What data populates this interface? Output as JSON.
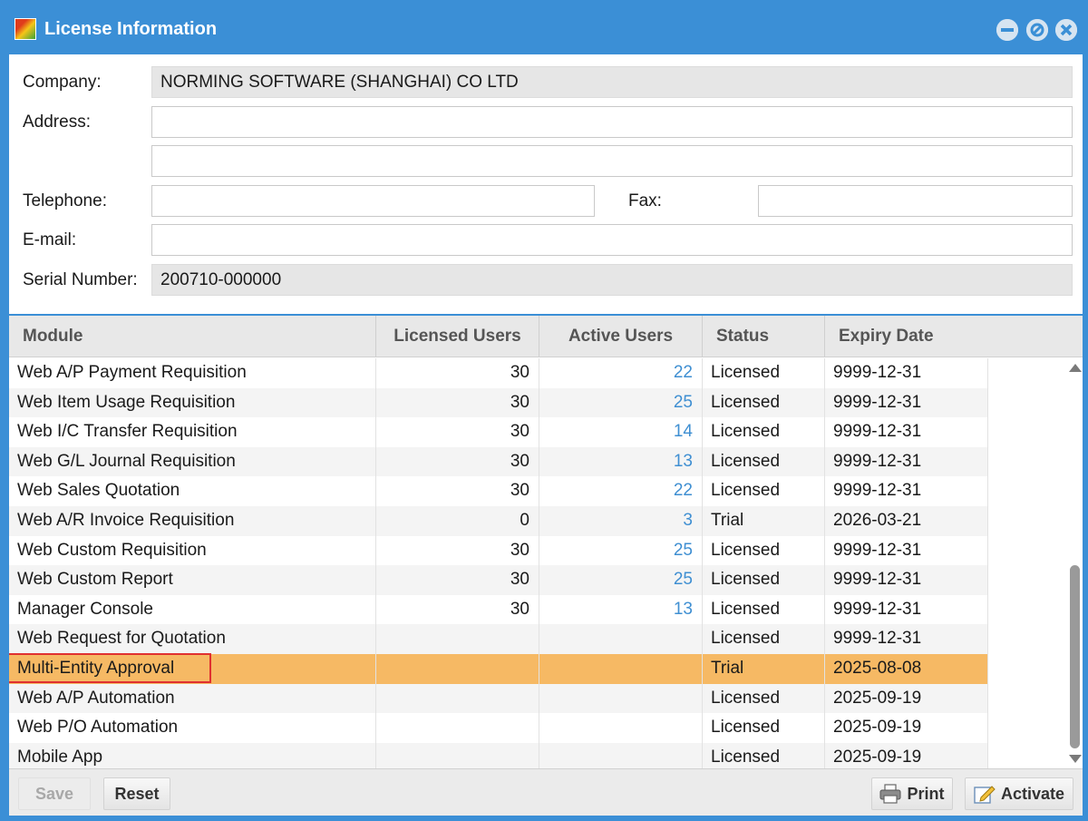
{
  "window": {
    "title": "License Information",
    "icon": "app-logo-icon"
  },
  "form": {
    "company_label": "Company:",
    "company_value": "NORMING SOFTWARE (SHANGHAI) CO LTD",
    "address_label": "Address:",
    "address_line1": "",
    "address_line2": "",
    "telephone_label": "Telephone:",
    "telephone_value": "",
    "fax_label": "Fax:",
    "fax_value": "",
    "email_label": "E-mail:",
    "email_value": "",
    "serial_label": "Serial Number:",
    "serial_value": "200710-000000"
  },
  "grid": {
    "headers": [
      "Module",
      "Licensed Users",
      "Active Users",
      "Status",
      "Expiry Date"
    ],
    "rows": [
      {
        "module": "Web A/P Payment Requisition",
        "licensed": "30",
        "active": "22",
        "status": "Licensed",
        "expiry": "9999-12-31"
      },
      {
        "module": "Web Item Usage Requisition",
        "licensed": "30",
        "active": "25",
        "status": "Licensed",
        "expiry": "9999-12-31"
      },
      {
        "module": "Web I/C Transfer Requisition",
        "licensed": "30",
        "active": "14",
        "status": "Licensed",
        "expiry": "9999-12-31"
      },
      {
        "module": "Web G/L Journal Requisition",
        "licensed": "30",
        "active": "13",
        "status": "Licensed",
        "expiry": "9999-12-31"
      },
      {
        "module": "Web Sales Quotation",
        "licensed": "30",
        "active": "22",
        "status": "Licensed",
        "expiry": "9999-12-31"
      },
      {
        "module": "Web A/R Invoice Requisition",
        "licensed": "0",
        "active": "3",
        "status": "Trial",
        "expiry": "2026-03-21"
      },
      {
        "module": "Web Custom Requisition",
        "licensed": "30",
        "active": "25",
        "status": "Licensed",
        "expiry": "9999-12-31"
      },
      {
        "module": "Web Custom Report",
        "licensed": "30",
        "active": "25",
        "status": "Licensed",
        "expiry": "9999-12-31"
      },
      {
        "module": "Manager Console",
        "licensed": "30",
        "active": "13",
        "status": "Licensed",
        "expiry": "9999-12-31"
      },
      {
        "module": "Web Request for Quotation",
        "licensed": "",
        "active": "",
        "status": "Licensed",
        "expiry": "9999-12-31"
      },
      {
        "module": "Multi-Entity Approval",
        "licensed": "",
        "active": "",
        "status": "Trial",
        "expiry": "2025-08-08",
        "selected": true
      },
      {
        "module": "Web A/P Automation",
        "licensed": "",
        "active": "",
        "status": "Licensed",
        "expiry": "2025-09-19"
      },
      {
        "module": "Web P/O Automation",
        "licensed": "",
        "active": "",
        "status": "Licensed",
        "expiry": "2025-09-19"
      },
      {
        "module": "Mobile App",
        "licensed": "",
        "active": "",
        "status": "Licensed",
        "expiry": "2025-09-19"
      }
    ]
  },
  "footer": {
    "save_label": "Save",
    "reset_label": "Reset",
    "print_label": "Print",
    "activate_label": "Activate"
  },
  "colors": {
    "titlebar": "#3b8fd6",
    "selected_row": "#f6b964",
    "active_users_text": "#3f8fd2",
    "highlight_border": "#e03030"
  }
}
